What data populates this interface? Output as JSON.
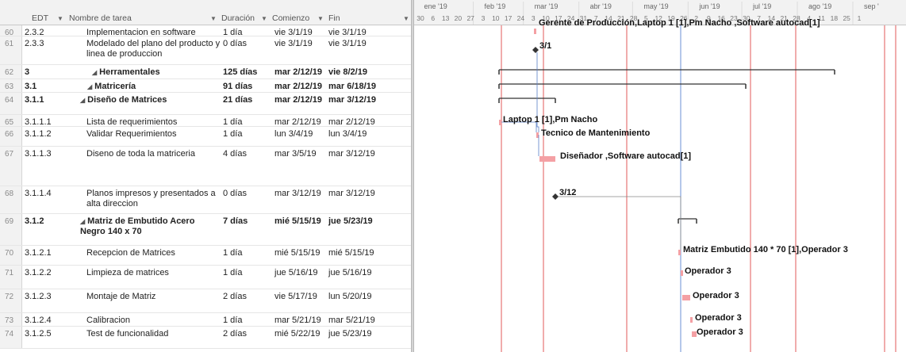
{
  "columns": {
    "edt": "EDT",
    "task": "Nombre de tarea",
    "duration": "Duración",
    "start": "Comienzo",
    "end": "Fin"
  },
  "timescale": {
    "months": [
      "ene '19",
      "feb '19",
      "mar '19",
      "abr '19",
      "may '19",
      "jun '19",
      "jul '19",
      "ago '19",
      "sep '"
    ],
    "days": [
      "30",
      "6",
      "13",
      "20",
      "27",
      "3",
      "10",
      "17",
      "24",
      "3",
      "10",
      "17",
      "24",
      "31",
      "7",
      "14",
      "21",
      "28",
      "5",
      "12",
      "19",
      "26",
      "2",
      "9",
      "16",
      "23",
      "30",
      "7",
      "14",
      "21",
      "28",
      "4",
      "11",
      "18",
      "25",
      "1"
    ]
  },
  "rows": [
    {
      "id": "60",
      "edt": "2.3.2",
      "name": "Implementacion en software",
      "dur": "1 día",
      "start": "vie 3/1/19",
      "end": "vie 3/1/19",
      "level": 3,
      "bold": false,
      "summary": false
    },
    {
      "id": "61",
      "edt": "2.3.3",
      "name": "Modelado del plano del producto y linea de produccion",
      "dur": "0 días",
      "start": "vie 3/1/19",
      "end": "vie 3/1/19",
      "level": 3,
      "bold": false,
      "summary": false
    },
    {
      "id": "62",
      "edt": "3",
      "name": "Herramentales",
      "dur": "125 días",
      "start": "mar 2/12/19",
      "end": "vie 8/2/19",
      "level": 0,
      "bold": true,
      "summary": true
    },
    {
      "id": "63",
      "edt": "3.1",
      "name": "Matricería",
      "dur": "91 días",
      "start": "mar 2/12/19",
      "end": "mar 6/18/19",
      "level": 1,
      "bold": true,
      "summary": true
    },
    {
      "id": "64",
      "edt": "3.1.1",
      "name": "Diseño de Matrices",
      "dur": "21 días",
      "start": "mar 2/12/19",
      "end": "mar 3/12/19",
      "level": 2,
      "bold": true,
      "summary": true
    },
    {
      "id": "65",
      "edt": "3.1.1.1",
      "name": "Lista de requerimientos",
      "dur": "1 día",
      "start": "mar 2/12/19",
      "end": "mar 2/12/19",
      "level": 3,
      "bold": false,
      "summary": false
    },
    {
      "id": "66",
      "edt": "3.1.1.2",
      "name": "Validar Requerimientos",
      "dur": "1 día",
      "start": "lun 3/4/19",
      "end": "lun 3/4/19",
      "level": 3,
      "bold": false,
      "summary": false
    },
    {
      "id": "67",
      "edt": "3.1.1.3",
      "name": "Diseno de toda la matriceria",
      "dur": "4 días",
      "start": "mar 3/5/19",
      "end": "mar 3/12/19",
      "level": 3,
      "bold": false,
      "summary": false
    },
    {
      "id": "68",
      "edt": "3.1.1.4",
      "name": "Planos impresos y presentados a alta direccion",
      "dur": "0 días",
      "start": "mar 3/12/19",
      "end": "mar 3/12/19",
      "level": 3,
      "bold": false,
      "summary": false
    },
    {
      "id": "69",
      "edt": "3.1.2",
      "name": "Matriz de Embutido Acero Negro 140 x 70",
      "dur": "7 días",
      "start": "mié 5/15/19",
      "end": "jue 5/23/19",
      "level": 2,
      "bold": true,
      "summary": true
    },
    {
      "id": "70",
      "edt": "3.1.2.1",
      "name": "Recepcion de Matrices",
      "dur": "1 día",
      "start": "mié 5/15/19",
      "end": "mié 5/15/19",
      "level": 3,
      "bold": false,
      "summary": false
    },
    {
      "id": "71",
      "edt": "3.1.2.2",
      "name": "Limpieza de matrices",
      "dur": "1 día",
      "start": "jue 5/16/19",
      "end": "jue 5/16/19",
      "level": 3,
      "bold": false,
      "summary": false
    },
    {
      "id": "72",
      "edt": "3.1.2.3",
      "name": "Montaje de Matriz",
      "dur": "2 días",
      "start": "vie 5/17/19",
      "end": "lun 5/20/19",
      "level": 3,
      "bold": false,
      "summary": false
    },
    {
      "id": "73",
      "edt": "3.1.2.4",
      "name": "Calibracion",
      "dur": "1 día",
      "start": "mar 5/21/19",
      "end": "mar 5/21/19",
      "level": 3,
      "bold": false,
      "summary": false
    },
    {
      "id": "74",
      "edt": "3.1.2.5",
      "name": "Test de funcionalidad",
      "dur": "2 días",
      "start": "mié 5/22/19",
      "end": "jue 5/23/19",
      "level": 3,
      "bold": false,
      "summary": false
    }
  ],
  "gantt": {
    "labels": [
      {
        "row": "60",
        "text": "Gerente de Producción,Laptop 1 [1],Pm Nacho ,Software autocad[1]"
      },
      {
        "row": "61",
        "text": "3/1"
      },
      {
        "row": "65",
        "text": "Laptop 1 [1],Pm Nacho"
      },
      {
        "row": "66",
        "text": "Tecnico de Mantenimiento"
      },
      {
        "row": "67",
        "text": "Diseñador ,Software autocad[1]"
      },
      {
        "row": "68",
        "text": "3/12"
      },
      {
        "row": "70",
        "text": "Matriz Embutido 140 * 70 [1],Operador 3"
      },
      {
        "row": "71",
        "text": "Operador 3"
      },
      {
        "row": "72",
        "text": "Operador 3"
      },
      {
        "row": "73",
        "text": "Operador 3"
      },
      {
        "row": "74",
        "text": "Operador 3"
      }
    ],
    "colors": {
      "bar": "#f4a0a4",
      "milestone": "#333333",
      "summary": "#333333",
      "redline": "#e05a5a",
      "today": "#6a8fd6",
      "link": "#5a7fc8"
    }
  }
}
